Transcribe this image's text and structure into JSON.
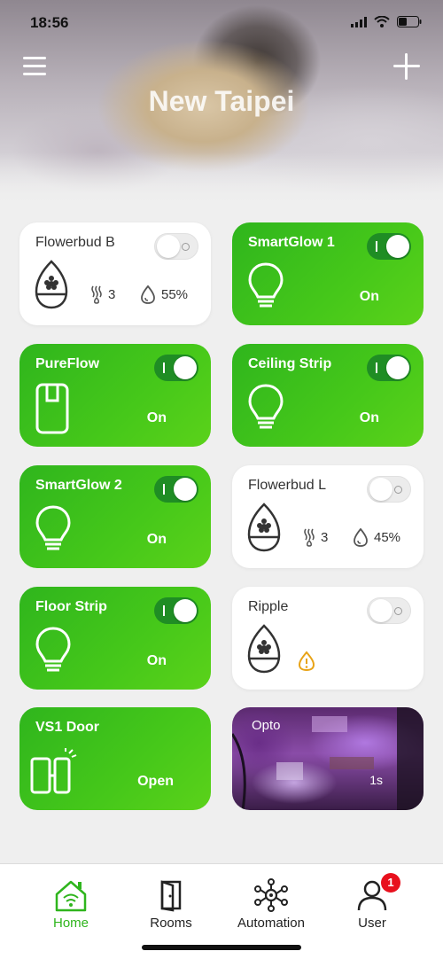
{
  "status_bar": {
    "time": "18:56"
  },
  "header": {
    "location": "New Taipei"
  },
  "devices": [
    {
      "name": "Flowerbud B",
      "toggle": "off",
      "stats": {
        "level": "3",
        "humidity": "55%"
      }
    },
    {
      "name": "SmartGlow 1",
      "toggle": "on",
      "state": "On"
    },
    {
      "name": "PureFlow",
      "toggle": "on",
      "state": "On"
    },
    {
      "name": "Ceiling Strip",
      "toggle": "on",
      "state": "On"
    },
    {
      "name": "SmartGlow 2",
      "toggle": "on",
      "state": "On"
    },
    {
      "name": "Flowerbud L",
      "toggle": "off",
      "stats": {
        "level": "3",
        "humidity": "45%"
      }
    },
    {
      "name": "Floor Strip",
      "toggle": "on",
      "state": "On"
    },
    {
      "name": "Ripple",
      "toggle": "off"
    },
    {
      "name": "VS1 Door",
      "state": "Open"
    }
  ],
  "camera": {
    "name": "Opto",
    "delay": "1s"
  },
  "nav": {
    "items": [
      {
        "label": "Home"
      },
      {
        "label": "Rooms"
      },
      {
        "label": "Automation"
      },
      {
        "label": "User",
        "badge": "1"
      }
    ]
  },
  "colors": {
    "accent_green": "#2fb51d",
    "toggle_on": "#1f8d24",
    "warning": "#e8a317",
    "badge_red": "#e8101d"
  },
  "icons": [
    "menu-icon",
    "add-icon",
    "humidifier-icon",
    "bulb-icon",
    "purifier-icon",
    "door-sensor-icon",
    "warning-icon",
    "home-icon",
    "door-icon",
    "automation-icon",
    "user-icon"
  ]
}
